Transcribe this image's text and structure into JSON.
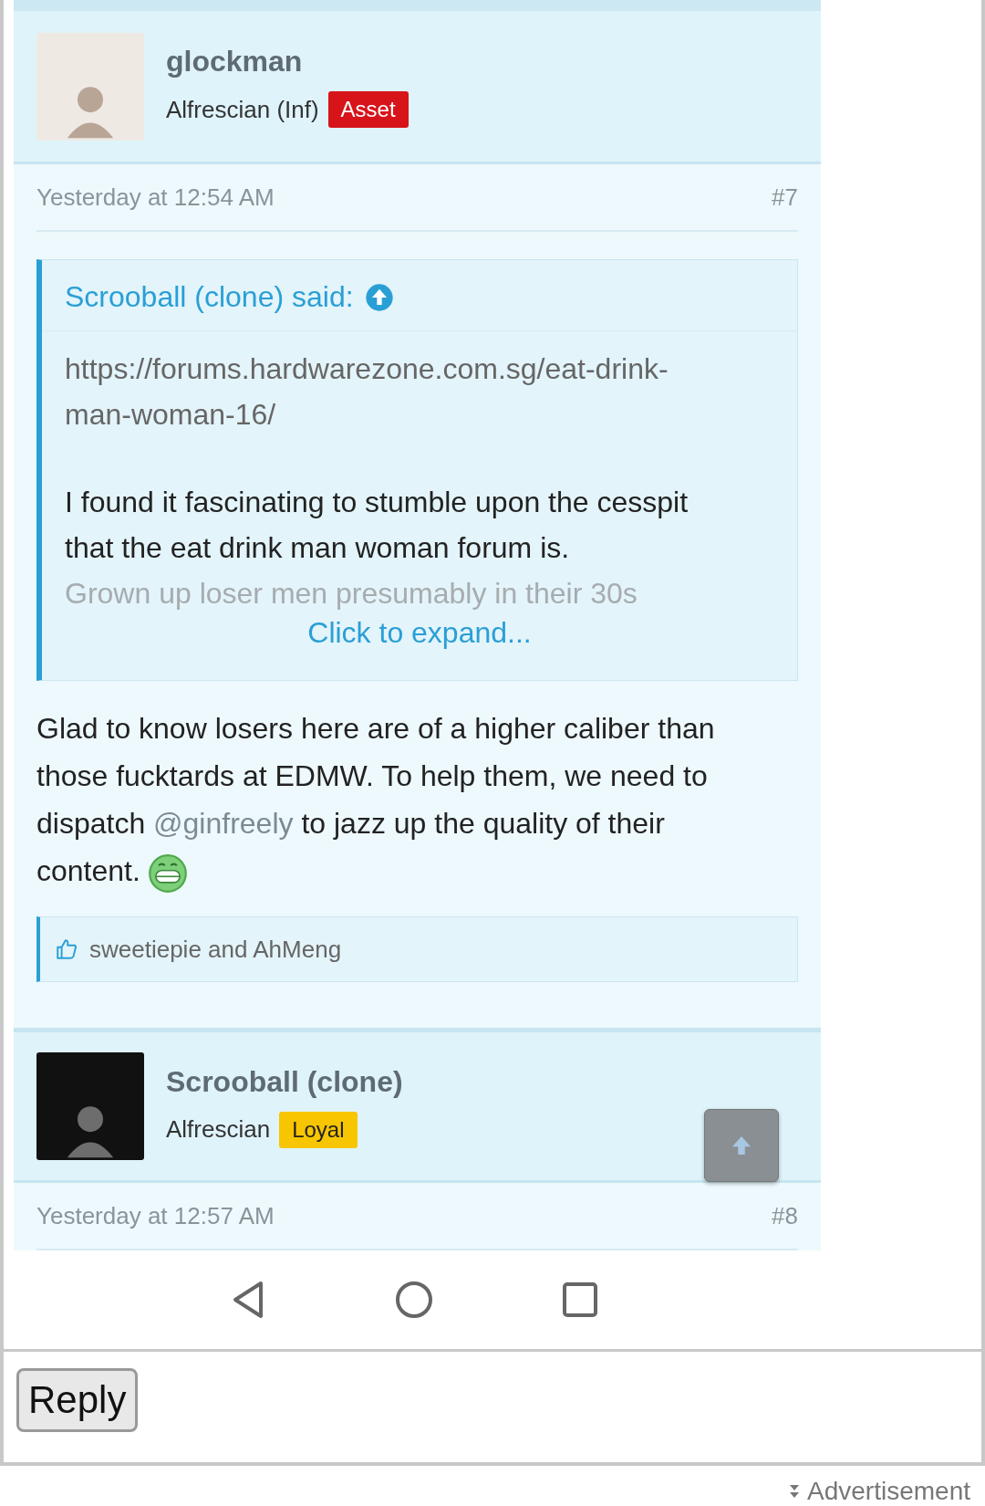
{
  "posts": [
    {
      "author": "glockman",
      "role": "Alfrescian (Inf)",
      "badge": {
        "label": "Asset",
        "color": "#d7141a"
      },
      "date": "Yesterday at 12:54 AM",
      "number": "#7",
      "quote": {
        "title": "Scrooball (clone) said:",
        "paragraphs": [
          {
            "kind": "muted",
            "text": "https://forums.hardwarezone.com.sg/eat-drink-man-woman-16/"
          },
          {
            "kind": "dark",
            "text": "I found it fascinating to stumble upon the cesspit that the eat drink man woman forum is."
          },
          {
            "kind": "faded",
            "text": "Grown up loser men presumably in their 30s"
          }
        ],
        "expand": "Click to expand..."
      },
      "message": [
        {
          "kind": "text",
          "text": "Glad to know losers here are of a higher caliber than those fucktards at EDMW. To help them, we need to dispatch "
        },
        {
          "kind": "mention",
          "text": "@ginfreely"
        },
        {
          "kind": "text",
          "text": " to jazz up the quality of their content."
        }
      ],
      "likes": "sweetiepie and AhMeng"
    },
    {
      "author": "Scrooball (clone)",
      "role": "Alfrescian",
      "badge": {
        "label": "Loyal",
        "color": "#f7c600"
      },
      "date": "Yesterday at 12:57 AM",
      "number": "#8"
    }
  ],
  "reply_button": "Reply",
  "advertisement": "Advertisement"
}
